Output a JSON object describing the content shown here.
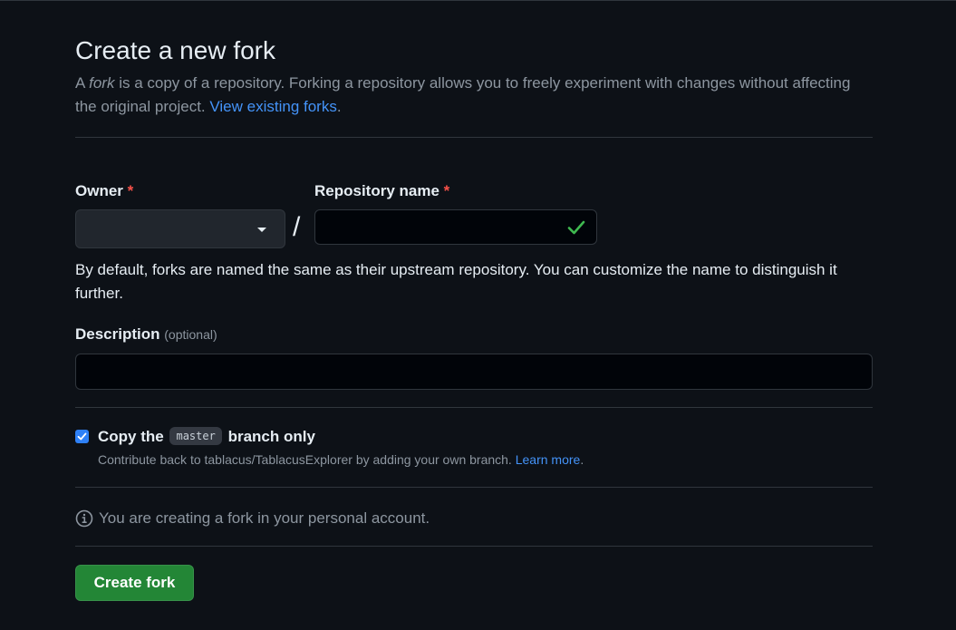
{
  "header": {
    "title": "Create a new fork",
    "intro_prefix": "A ",
    "intro_fork_word": "fork",
    "intro_rest": " is a copy of a repository. Forking a repository allows you to freely experiment with changes without affecting the original project. ",
    "view_forks_link": "View existing forks",
    "intro_end": "."
  },
  "owner": {
    "label": "Owner",
    "required_mark": "*",
    "selected_value": ""
  },
  "separator": "/",
  "repository": {
    "label": "Repository name",
    "required_mark": "*",
    "value": "",
    "valid": true
  },
  "hint": "By default, forks are named the same as their upstream repository. You can customize the name to distinguish it further.",
  "description": {
    "label": "Description",
    "optional_label": "(optional)",
    "value": ""
  },
  "copy_branch": {
    "checked": true,
    "label_prefix": "Copy the",
    "branch_name": "master",
    "label_suffix": "branch only",
    "note_text": "Contribute back to tablacus/TablacusExplorer by adding your own branch. ",
    "learn_more": "Learn more",
    "note_end": "."
  },
  "info": {
    "icon": "info-icon",
    "text": "You are creating a fork in your personal account."
  },
  "submit": {
    "label": "Create fork"
  },
  "colors": {
    "background": "#0d1117",
    "accent_link": "#4493f8",
    "required": "#f85149",
    "success": "#3fb950",
    "button_green": "#238636",
    "checkbox": "#2f81f7"
  }
}
